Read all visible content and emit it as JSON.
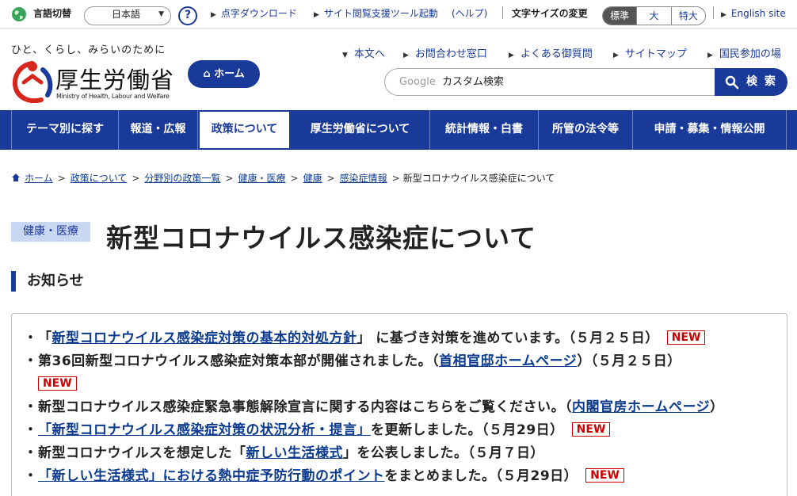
{
  "utility": {
    "language_label": "言語切替",
    "language_value": "日本語",
    "help_icon_text": "?",
    "braille_download": "点字ダウンロード",
    "accessibility_tool": "サイト閲覧支援ツール起動",
    "help_link": "(ヘルプ)",
    "font_size_label": "文字サイズの変更",
    "font_sizes": [
      "標準",
      "大",
      "特大"
    ],
    "english_site": "English site"
  },
  "header": {
    "tagline": "ひと、くらし、みらいのために",
    "logo_text": "厚生労働省",
    "logo_subtext": "Ministry of Health, Labour and Welfare",
    "home_button": "ホーム",
    "sub_links": [
      "本文へ",
      "お問合わせ窓口",
      "よくある御質問",
      "サイトマップ",
      "国民参加の場"
    ],
    "search_brand": "Google",
    "search_placeholder": "カスタム検索",
    "search_button": "検 索"
  },
  "nav": {
    "items": [
      "テーマ別に探す",
      "報道・広報",
      "政策について",
      "厚生労働省について",
      "統計情報・白書",
      "所管の法令等",
      "申請・募集・情報公開"
    ],
    "active_index": 2
  },
  "breadcrumb": {
    "items": [
      "ホーム",
      "政策について",
      "分野別の政策一覧",
      "健康・医療",
      "健康",
      "感染症情報"
    ],
    "current": "新型コロナウイルス感染症について"
  },
  "page": {
    "category": "健康・医療",
    "title": "新型コロナウイルス感染症について",
    "section_heading": "お知らせ"
  },
  "notices": {
    "new_badge": "NEW",
    "items": [
      {
        "pre": "「",
        "link": "新型コロナウイルス感染症対策の基本的対処方針",
        "post": "」 に基づき対策を進めています。（５月２５日）"
      },
      {
        "pre": "第36回新型コロナウイルス感染症対策本部が開催されました。（",
        "link": "首相官邸ホームページ",
        "post": "）（５月２５日）"
      },
      {
        "pre": "新型コロナウイルス感染症緊急事態解除宣言に関する内容はこちらをご覧ください。（",
        "link": "内閣官房ホームページ",
        "post": "）"
      },
      {
        "pre": "",
        "link": "「新型コロナウイルス感染症対策の状況分析・提言」",
        "post": "を更新しました。（５月29日）"
      },
      {
        "pre": "新型コロナウイルスを想定した「",
        "link": "新しい生活様式",
        "post": "」を公表しました。（５月７日）"
      },
      {
        "pre": "",
        "link": "「新しい生活様式」における熱中症予防行動のポイント",
        "post": "をまとめました。（５月29日）"
      }
    ]
  },
  "colors": {
    "brand_navy": "#1a3a9a",
    "category_bg": "#c9d7f2",
    "new_red": "#cc0000"
  }
}
